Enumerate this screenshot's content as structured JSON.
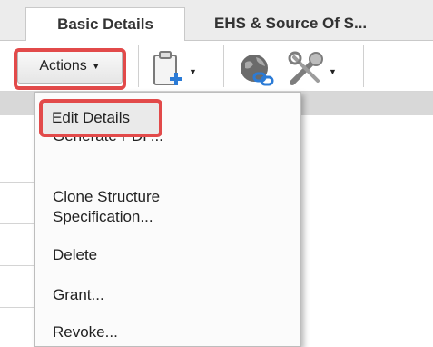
{
  "tabs": [
    {
      "label": "Basic Details",
      "active": true
    },
    {
      "label": "EHS & Source Of S...",
      "active": false
    }
  ],
  "toolbar": {
    "actions_label": "Actions",
    "icons": [
      "new-document-icon",
      "globe-link-icon",
      "tools-icon"
    ]
  },
  "menu": {
    "items": [
      {
        "label": "Edit Details",
        "highlighted": true
      },
      {
        "label": "Generate PDF..."
      },
      {
        "label": "Clone Structure\nSpecification..."
      },
      {
        "label": "Delete"
      },
      {
        "label": "Grant..."
      },
      {
        "label": "Revoke..."
      }
    ]
  },
  "colors": {
    "highlight": "#e24a4a",
    "tab_bar": "#ececec",
    "band": "#d8d8d8"
  }
}
